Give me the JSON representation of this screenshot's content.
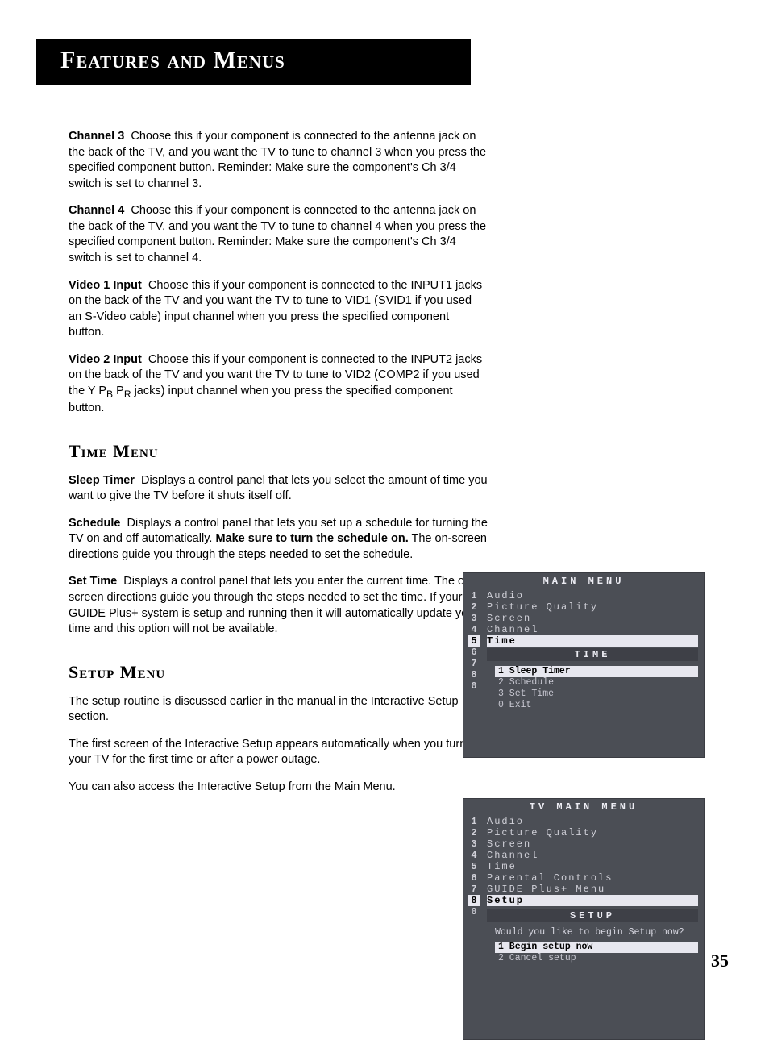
{
  "header": {
    "title": "Features and Menus"
  },
  "paras": {
    "ch3": {
      "label": "Channel 3",
      "text": "Choose this if your component is connected to the antenna jack on the back of the TV, and you want the TV to tune to channel 3 when you press the specified component button. Reminder: Make sure the component's Ch 3/4 switch is set to channel 3."
    },
    "ch4": {
      "label": "Channel 4",
      "text": "Choose this if your component is connected to the antenna jack on the back of the TV, and you want the TV to tune to channel 4 when you press the specified component button. Reminder: Make sure the component's Ch 3/4 switch is set to channel 4."
    },
    "vid1": {
      "label": "Video 1 Input",
      "text": "Choose this if your component is connected to the INPUT1 jacks on the back of the TV and you want the TV to tune to VID1 (SVID1 if you used an S-Video cable) input channel when you press the specified component button."
    },
    "vid2": {
      "label": "Video 2 Input",
      "text_a": "Choose this if your component is connected to the INPUT2 jacks on the back of the TV and you want the TV to tune to VID2 (COMP2 if you used the Y P",
      "text_b": " P",
      "text_c": " jacks) input channel when you press the specified component button."
    }
  },
  "time": {
    "heading": "Time Menu",
    "sleep": {
      "label": "Sleep Timer",
      "text": "Displays a control panel that lets you select the amount of time you want to give the TV before it shuts itself off."
    },
    "schedule": {
      "label": "Schedule",
      "text_a": "Displays a control panel that lets you set up a schedule for turning the TV on and off automatically. ",
      "bold": "Make sure to turn the schedule on.",
      "text_b": " The on-screen directions guide you through the steps needed to set the schedule."
    },
    "settime": {
      "label": "Set Time",
      "text": "Displays a control panel that lets you enter the current time. The on-screen directions guide you through the steps needed to set the time. If your GUIDE Plus+ system is setup and running then it will automatically update your time and this option will not be available."
    }
  },
  "setup": {
    "heading": "Setup Menu",
    "p1": "The setup routine is discussed earlier in the manual in the Interactive Setup section.",
    "p2": "The first screen of the Interactive Setup appears automatically when you turn on your TV for the first time or after a power outage.",
    "p3": "You can also access the Interactive Setup from the Main Menu."
  },
  "menu1": {
    "title": "MAIN MENU",
    "nums": [
      "1",
      "2",
      "3",
      "4",
      "5",
      "6",
      "7",
      "8",
      "0"
    ],
    "items": [
      "Audio",
      "Picture Quality",
      "Screen",
      "Channel",
      "Time"
    ],
    "sub_title": "TIME",
    "sub_items": [
      "1 Sleep Timer",
      "2 Schedule",
      "3 Set Time",
      "0 Exit"
    ]
  },
  "menu2": {
    "title": "TV MAIN MENU",
    "nums": [
      "1",
      "2",
      "3",
      "4",
      "5",
      "6",
      "7",
      "8",
      "0"
    ],
    "items": [
      "Audio",
      "Picture Quality",
      "Screen",
      "Channel",
      "Time",
      "Parental Controls",
      "GUIDE Plus+ Menu",
      "Setup"
    ],
    "sub_title": "SETUP",
    "prompt": "Would you like to begin Setup now?",
    "sub_items": [
      "1 Begin setup now",
      "2 Cancel setup"
    ]
  },
  "page_number": "35",
  "sub": {
    "b": "B",
    "r": "R"
  }
}
